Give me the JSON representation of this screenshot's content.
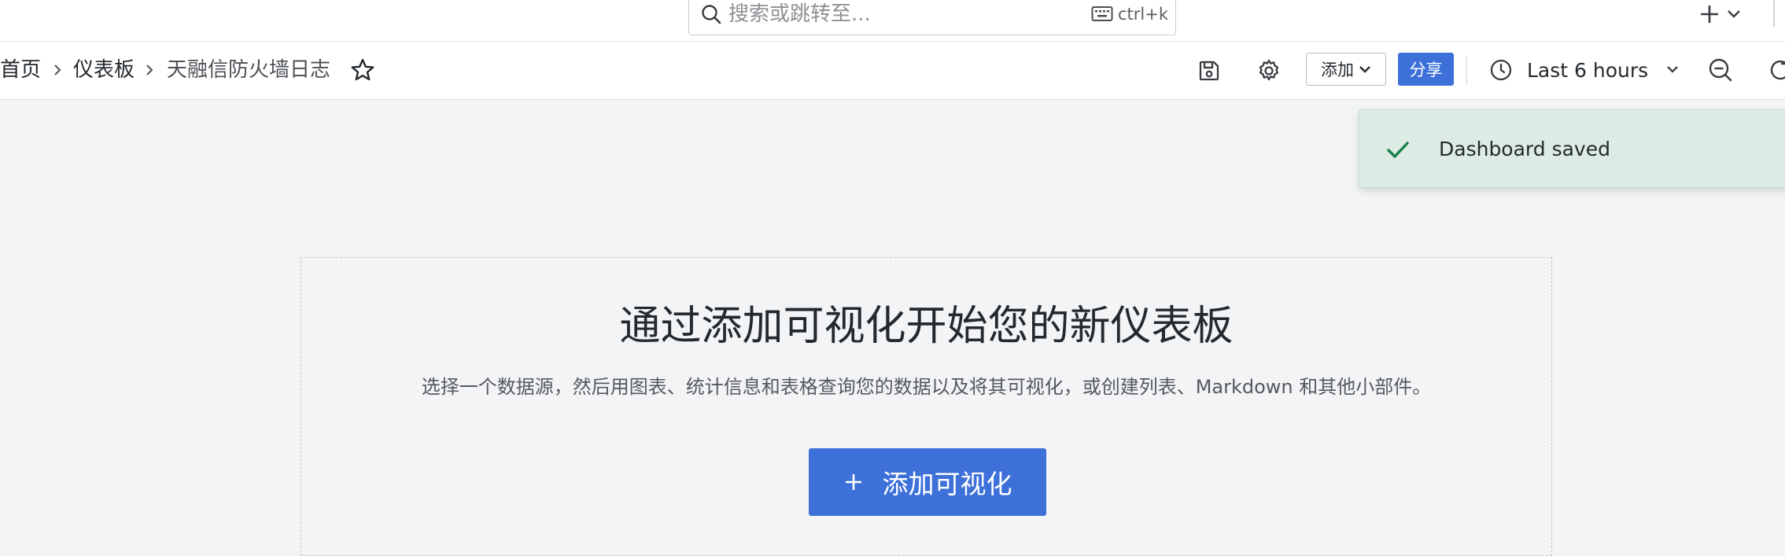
{
  "colors": {
    "primary": "#3d71d9",
    "success_bg": "#dcebe3",
    "success_icon": "#1a7f4b",
    "page_bg": "#f3f4f5"
  },
  "search": {
    "placeholder": "搜索或跳转至...",
    "shortcut": "ctrl+k",
    "icon": "search-icon",
    "kbd_icon": "keyboard-icon"
  },
  "topbar": {
    "new_icon": "plus-icon",
    "new_chevron": "chevron-down-icon"
  },
  "breadcrumb": {
    "home": "首页",
    "dashboards": "仪表板",
    "current": "天融信防火墙日志",
    "separator_icon": "chevron-right-icon"
  },
  "toolbar": {
    "star_icon": "star-icon",
    "save_icon": "save-icon",
    "settings_icon": "gear-icon",
    "add_label": "添加",
    "share_label": "分享",
    "time_range": "Last 6 hours",
    "zoom_out_icon": "zoom-out-icon",
    "refresh_icon": "refresh-icon"
  },
  "toast": {
    "message": "Dashboard saved",
    "icon": "check-icon"
  },
  "empty_state": {
    "title": "通过添加可视化开始您的新仪表板",
    "description": "选择一个数据源，然后用图表、统计信息和表格查询您的数据以及将其可视化，或创建列表、Markdown 和其他小部件。",
    "button_label": "添加可视化"
  }
}
